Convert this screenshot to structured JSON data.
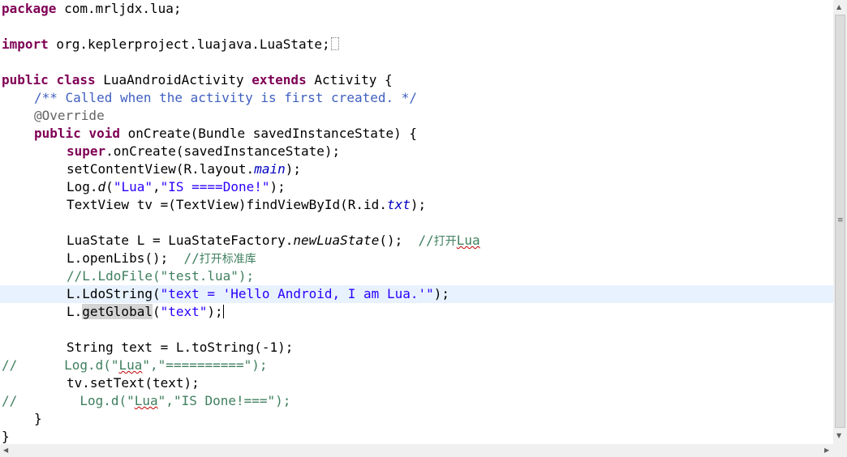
{
  "editor": {
    "current_line_index": 16,
    "colors": {
      "keyword": "#7f0055",
      "string": "#2a00ff",
      "comment": "#3f7f5f",
      "javadoc": "#3f5fbf",
      "annotation": "#646464",
      "field": "#0000c0",
      "current_line": "#e8f2fe",
      "selection_highlight": "#d4d4d4"
    },
    "lines": [
      {
        "indent": 0,
        "tokens": [
          {
            "t": "package",
            "c": "kw"
          },
          {
            "t": " com.mrljdx.lua;"
          }
        ]
      },
      {
        "indent": 0,
        "tokens": []
      },
      {
        "indent": 0,
        "tokens": [
          {
            "t": "import",
            "c": "kw"
          },
          {
            "t": " org.keplerproject.luajava.LuaState;"
          },
          {
            "t": "",
            "c": "fold"
          }
        ]
      },
      {
        "indent": 0,
        "tokens": []
      },
      {
        "indent": 0,
        "tokens": [
          {
            "t": "public",
            "c": "kw"
          },
          {
            "t": " "
          },
          {
            "t": "class",
            "c": "kw"
          },
          {
            "t": " LuaAndroidActivity "
          },
          {
            "t": "extends",
            "c": "kw"
          },
          {
            "t": " Activity {"
          }
        ]
      },
      {
        "indent": 4,
        "tokens": [
          {
            "t": "/** Called when the activity is first created. */",
            "c": "jdoc"
          }
        ]
      },
      {
        "indent": 4,
        "tokens": [
          {
            "t": "@Override",
            "c": "ann"
          }
        ]
      },
      {
        "indent": 4,
        "tokens": [
          {
            "t": "public",
            "c": "kw"
          },
          {
            "t": " "
          },
          {
            "t": "void",
            "c": "kw"
          },
          {
            "t": " onCreate(Bundle savedInstanceState) {"
          }
        ]
      },
      {
        "indent": 8,
        "tokens": [
          {
            "t": "super",
            "c": "kw"
          },
          {
            "t": ".onCreate(savedInstanceState);"
          }
        ]
      },
      {
        "indent": 8,
        "tokens": [
          {
            "t": "setContentView(R.layout."
          },
          {
            "t": "main",
            "c": "fld"
          },
          {
            "t": ");"
          }
        ]
      },
      {
        "indent": 8,
        "tokens": [
          {
            "t": "Log."
          },
          {
            "t": "d",
            "c": "st"
          },
          {
            "t": "("
          },
          {
            "t": "\"Lua\"",
            "c": "str"
          },
          {
            "t": ","
          },
          {
            "t": "\"IS ====Done!\"",
            "c": "str"
          },
          {
            "t": ");"
          }
        ]
      },
      {
        "indent": 8,
        "tokens": [
          {
            "t": "TextView tv =(TextView)findViewById(R.id."
          },
          {
            "t": "txt",
            "c": "fld"
          },
          {
            "t": ");"
          }
        ]
      },
      {
        "indent": 0,
        "tokens": []
      },
      {
        "indent": 8,
        "tokens": [
          {
            "t": "LuaState L = LuaStateFactory."
          },
          {
            "t": "newLuaState",
            "c": "st"
          },
          {
            "t": "();  "
          },
          {
            "t": "//",
            "c": "cmt"
          },
          {
            "t": "打开",
            "c": "cmt cjk"
          },
          {
            "t": "Lua",
            "c": "cmt sq"
          }
        ]
      },
      {
        "indent": 8,
        "tokens": [
          {
            "t": "L.openLibs();  "
          },
          {
            "t": "//",
            "c": "cmt"
          },
          {
            "t": "打开标准库",
            "c": "cmt cjk"
          }
        ]
      },
      {
        "indent": 8,
        "tokens": [
          {
            "t": "//L.LdoFile(\"test.lua\");",
            "c": "cmt"
          }
        ]
      },
      {
        "indent": 8,
        "tokens": [
          {
            "t": "L.LdoString("
          },
          {
            "t": "\"text = 'Hello Android, I am Lua.'\"",
            "c": "str"
          },
          {
            "t": ");"
          }
        ]
      },
      {
        "indent": 8,
        "tokens": [
          {
            "t": "L."
          },
          {
            "t": "getGlobal",
            "c": "hl"
          },
          {
            "t": "("
          },
          {
            "t": "\"text\"",
            "c": "str"
          },
          {
            "t": ");"
          },
          {
            "t": "",
            "c": "caret"
          }
        ]
      },
      {
        "indent": 0,
        "tokens": []
      },
      {
        "indent": 8,
        "tokens": [
          {
            "t": "String text = L.toString(-1);"
          }
        ]
      },
      {
        "indent": 0,
        "tokens": [
          {
            "t": "//      Log.d(\"",
            "c": "cmt"
          },
          {
            "t": "Lua",
            "c": "cmt sq"
          },
          {
            "t": "\",\"==========\");",
            "c": "cmt"
          }
        ]
      },
      {
        "indent": 8,
        "tokens": [
          {
            "t": "tv.setText(text);"
          }
        ]
      },
      {
        "indent": 0,
        "tokens": [
          {
            "t": "//        Log.d(\"",
            "c": "cmt"
          },
          {
            "t": "Lua",
            "c": "cmt sq"
          },
          {
            "t": "\",\"IS Done!===\");",
            "c": "cmt"
          }
        ]
      },
      {
        "indent": 4,
        "tokens": [
          {
            "t": "}"
          }
        ]
      },
      {
        "indent": 0,
        "tokens": [
          {
            "t": "}"
          }
        ]
      }
    ]
  },
  "scrollbars": {
    "vertical": {
      "up_arrow": "▲",
      "down_arrow": "▼",
      "grip": "≡"
    },
    "horizontal": {
      "left_arrow": "◀",
      "right_arrow": "▶"
    }
  }
}
